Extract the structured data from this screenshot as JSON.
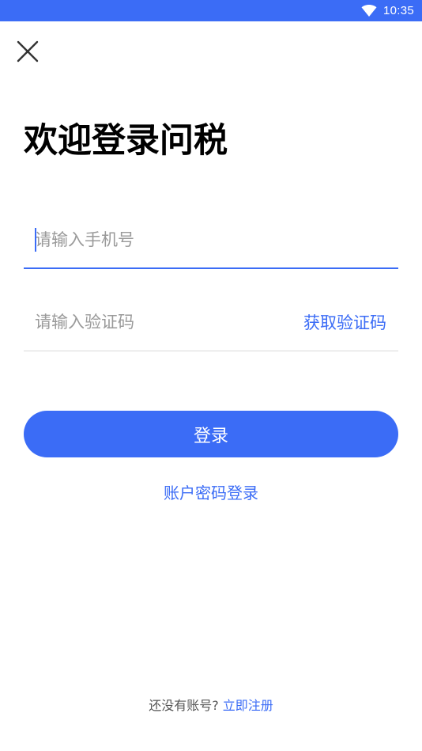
{
  "status_bar": {
    "time": "10:35",
    "icons": [
      "wifi-icon"
    ],
    "background": "#3b6cf6"
  },
  "header": {
    "close_icon": "close-icon"
  },
  "title": "欢迎登录问税",
  "phone": {
    "placeholder": "请输入手机号",
    "value": ""
  },
  "code": {
    "placeholder": "请输入验证码",
    "value": "",
    "get_code_label": "获取验证码"
  },
  "login_button": {
    "label": "登录"
  },
  "password_login_link": "账户密码登录",
  "footer": {
    "prompt": "还没有账号?",
    "register_label": "立即注册"
  },
  "colors": {
    "accent": "#3b6cf6",
    "placeholder": "#9a9a9a",
    "divider": "#d9d9d9"
  }
}
